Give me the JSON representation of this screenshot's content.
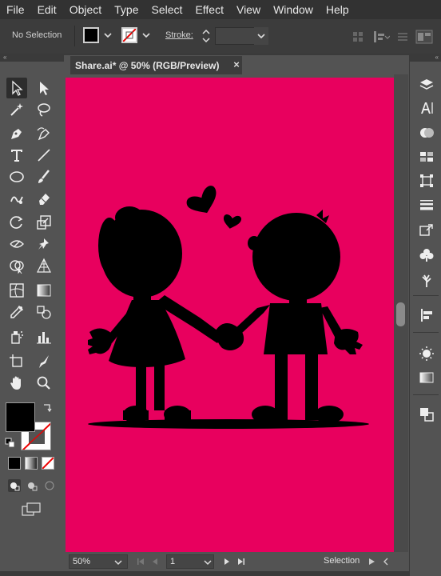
{
  "menu": [
    "File",
    "Edit",
    "Object",
    "Type",
    "Select",
    "Effect",
    "View",
    "Window",
    "Help"
  ],
  "control": {
    "selection_status": "No Selection",
    "stroke_label": "Stroke:"
  },
  "panels": {
    "collapse_left": "«",
    "collapse_right": "«"
  },
  "document": {
    "tab_title": "Share.ai* @ 50% (RGB/Preview)",
    "close_symbol": "×"
  },
  "status": {
    "zoom": "50%",
    "artboard_number": "1",
    "current_tool": "Selection"
  },
  "colors": {
    "artboard": "#e8005e",
    "silhouette": "#000000",
    "fill": "#000000",
    "stroke": "none"
  },
  "tools": [
    "selection-tool",
    "direct-selection-tool",
    "magic-wand-tool",
    "lasso-tool",
    "pen-tool",
    "curvature-tool",
    "type-tool",
    "line-segment-tool",
    "ellipse-tool",
    "paintbrush-tool",
    "shaper-tool",
    "eraser-tool",
    "rotate-tool",
    "scale-tool",
    "width-tool",
    "puppet-warp-tool",
    "shape-builder-tool",
    "perspective-grid-tool",
    "mesh-tool",
    "gradient-tool",
    "eyedropper-tool",
    "blend-tool",
    "symbol-sprayer-tool",
    "column-graph-tool",
    "artboard-tool",
    "slice-tool",
    "hand-tool",
    "zoom-tool"
  ],
  "right_panels": [
    "layers-icon",
    "character-icon",
    "appearance-icon",
    "swatches-icon",
    "transform-icon",
    "stroke-icon",
    "links-icon",
    "symbols-icon",
    "libraries-icon",
    "align-icon",
    "brightness-icon",
    "gradient-icon",
    "pathfinder-icon"
  ]
}
